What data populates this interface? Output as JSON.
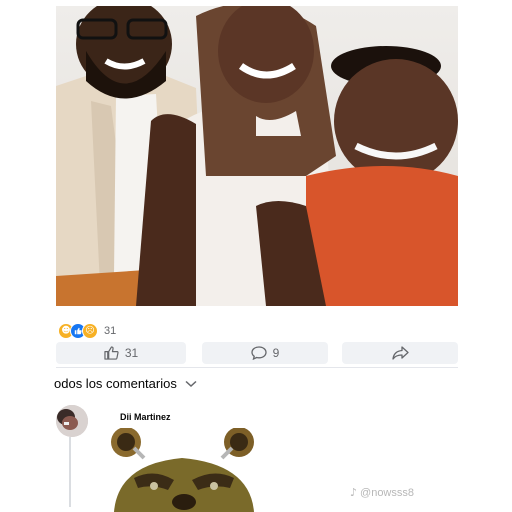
{
  "post": {
    "reaction_count": "31",
    "reactions": [
      {
        "icon": "haha-reaction-icon",
        "color": "#f7b125"
      },
      {
        "icon": "like-reaction-icon",
        "color": "#1877f2"
      },
      {
        "icon": "sad-reaction-icon",
        "color": "#f7b125"
      }
    ]
  },
  "actions": {
    "like_count": "31",
    "comment_count": "9"
  },
  "comments_section": {
    "filter_label": "odos los comentarios"
  },
  "comment": {
    "author": "Dii Martinez"
  },
  "watermark": {
    "handle": "@nowsss8"
  }
}
